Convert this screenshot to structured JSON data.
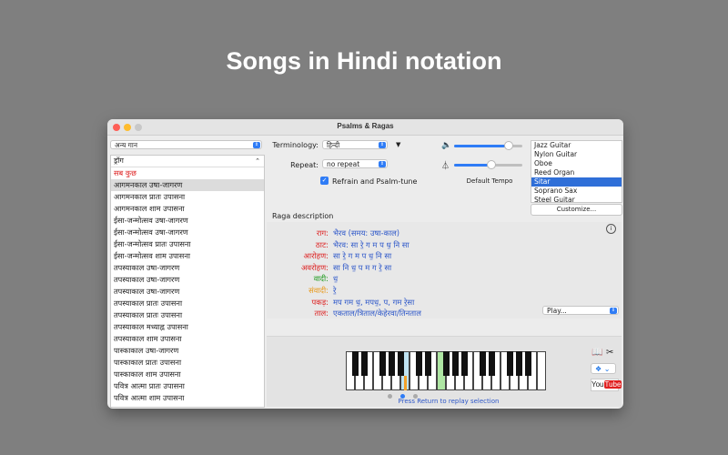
{
  "headline": "Songs in Hindi notation",
  "window": {
    "title": "Psalms & Ragas"
  },
  "left": {
    "category_select": "अन्य गान",
    "list_header": "ड्रॉग",
    "items": [
      {
        "label": "सब कुछ",
        "style": "red"
      },
      {
        "label": "आगमनकाल उषा-जागरण",
        "style": "hl"
      },
      {
        "label": "आगमनकाल प्रातः उपासना",
        "style": ""
      },
      {
        "label": "आगमनकाल शाम उपासना",
        "style": ""
      },
      {
        "label": "ईसा-जन्मोत्सव उषा-जागरण",
        "style": ""
      },
      {
        "label": "ईसा-जन्मोत्सव उषा-जागरण",
        "style": ""
      },
      {
        "label": "ईसा-जन्मोत्सव प्रातः उपासना",
        "style": ""
      },
      {
        "label": "ईसा-जन्मोत्सव शाम उपासना",
        "style": ""
      },
      {
        "label": "तपस्याकाल उषा-जागरण",
        "style": ""
      },
      {
        "label": "तपस्याकाल उषा-जागरण",
        "style": ""
      },
      {
        "label": "तपस्याकाल उषा-जागरण",
        "style": ""
      },
      {
        "label": "तपस्याकाल प्रातः उपासना",
        "style": ""
      },
      {
        "label": "तपस्याकाल प्रातः उपासना",
        "style": ""
      },
      {
        "label": "तपस्याकाल मध्याह्न उपासना",
        "style": ""
      },
      {
        "label": "तपस्याकाल शाम उपासना",
        "style": ""
      },
      {
        "label": "पास्काकाल उषा-जागरण",
        "style": ""
      },
      {
        "label": "पास्काकाल प्रातः उपासना",
        "style": ""
      },
      {
        "label": "पास्काकाल शाम उपासना",
        "style": ""
      },
      {
        "label": "पवित्र आत्मा प्रातः उपासना",
        "style": ""
      },
      {
        "label": "पवित्र आत्मा शाम उपासना",
        "style": ""
      }
    ]
  },
  "controls": {
    "terminology_label": "Terminology:",
    "terminology_value": "हिन्दी",
    "repeat_label": "Repeat:",
    "repeat_value": "no repeat",
    "refrain_label": "Refrain and Psalm-tune",
    "refrain_checked": true,
    "default_tempo_label": "Default Tempo",
    "volume_level": 0.8,
    "tempo_level": 0.55
  },
  "instruments": {
    "items": [
      "Jazz Guitar",
      "Nylon Guitar",
      "Oboe",
      "Reed Organ",
      "Sitar",
      "Soprano Sax",
      "Steel Guitar"
    ],
    "selected": "Sitar",
    "customize_label": "Customize..."
  },
  "raga": {
    "section_label": "Raga description",
    "rows": [
      {
        "key": "राग:",
        "value": "भैरव (समय: उषा-काल)",
        "color": "#d22"
      },
      {
        "key": "ठाट:",
        "value": "भैरव: सा रे॒ ग म प ध॒ नि सा",
        "color": "#d22"
      },
      {
        "key": "आरोहण:",
        "value": "सा रे॒ ग म प ध॒ नि सा",
        "color": "#d22"
      },
      {
        "key": "अवरोहण:",
        "value": "सा नि ध॒ प म ग रे॒ सा",
        "color": "#d22"
      },
      {
        "key": "वादी:",
        "value": "ध॒",
        "color": "#1e9a1e"
      },
      {
        "key": "संवादी:",
        "value": "रे॒",
        "color": "#e89a1c"
      },
      {
        "key": "पकड़:",
        "value": "मप गम ध॒, मपध॒, प, गम रे॒सा",
        "color": "#d22"
      },
      {
        "key": "ताल:",
        "value": "एकताल/त्रिताल/केहेरवा/तिनताल",
        "color": "#d22"
      }
    ],
    "play_select": "Play..."
  },
  "keyboard": {
    "hint": "Press Return to replay selection",
    "white_key_count": 22,
    "highlight_white": [
      {
        "index": 6,
        "color": "#bfe3f2"
      },
      {
        "index": 10,
        "color": "#aee6a3"
      }
    ],
    "marker_white": 6,
    "dots": [
      false,
      true,
      false
    ]
  },
  "right_icons": {
    "book": "book-icon",
    "tools": "tools-icon",
    "dropbox": "dropbox-icon",
    "youtube": "YouTube"
  },
  "colors": {
    "accent": "#2f7cf6",
    "select_row": "#2f6fd8",
    "red": "#d22",
    "blue_text": "#2d57c9"
  }
}
